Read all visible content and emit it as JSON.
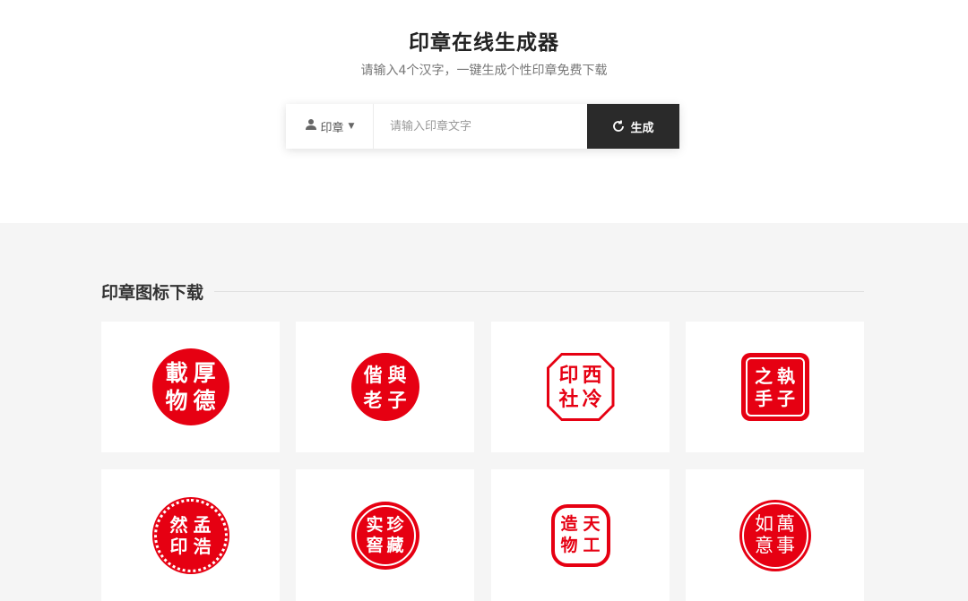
{
  "header": {
    "title": "印章在线生成器",
    "subtitle": "请输入4个汉字，一键生成个性印章免费下载"
  },
  "generator": {
    "type_label": "印章",
    "type_icon": "user-icon",
    "input_placeholder": "请输入印章文字",
    "input_value": "",
    "button_label": "生成",
    "button_icon": "refresh-icon"
  },
  "section": {
    "title": "印章图标下载"
  },
  "colors": {
    "seal_red": "#e60012",
    "button_dark": "#2a2a2a",
    "page_bg": "#f5f5f5"
  },
  "seals": [
    {
      "chars": [
        "載",
        "厚",
        "物",
        "德"
      ]
    },
    {
      "chars": [
        "偕",
        "與",
        "老",
        "子"
      ]
    },
    {
      "chars": [
        "印",
        "西",
        "社",
        "冷"
      ]
    },
    {
      "chars": [
        "之",
        "執",
        "手",
        "子"
      ]
    },
    {
      "chars": [
        "然",
        "孟",
        "印",
        "浩"
      ]
    },
    {
      "chars": [
        "实",
        "珍",
        "窖",
        "藏"
      ]
    },
    {
      "chars": [
        "造",
        "天",
        "物",
        "工"
      ]
    },
    {
      "chars": [
        "如",
        "萬",
        "意",
        "事"
      ]
    }
  ]
}
